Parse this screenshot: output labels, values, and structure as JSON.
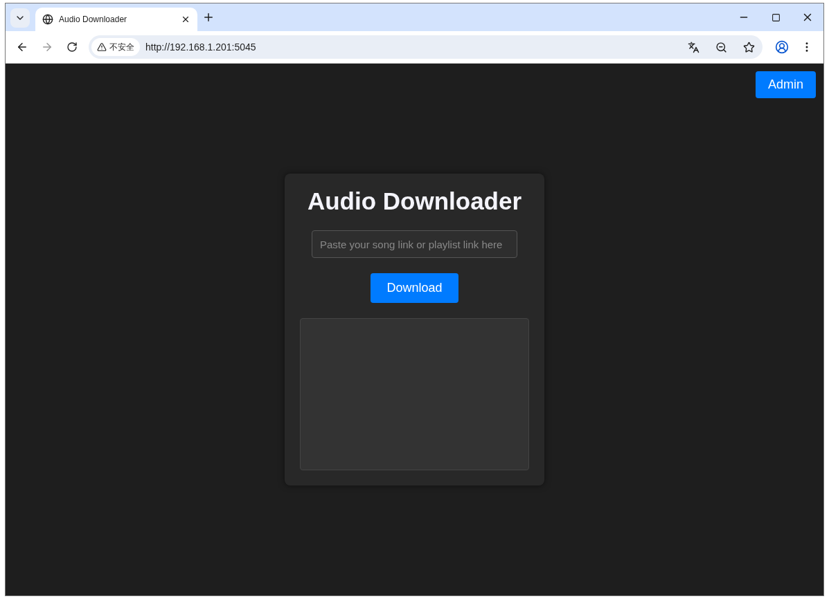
{
  "browser": {
    "tab": {
      "title": "Audio Downloader",
      "selected": true
    },
    "security_label": "不安全",
    "url": "http://192.168.1.201:5045"
  },
  "page": {
    "admin_button": "Admin",
    "title": "Audio Downloader",
    "input": {
      "placeholder": "Paste your song link or playlist link here"
    },
    "download_button": "Download"
  }
}
